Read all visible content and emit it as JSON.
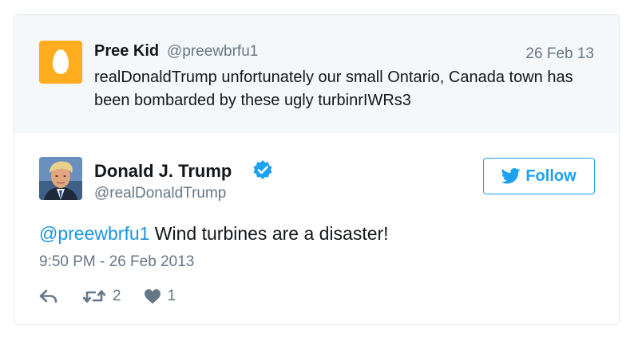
{
  "parent_tweet": {
    "name": "Pree Kid",
    "handle": "@preewbrfu1",
    "date": "26 Feb 13",
    "text": "realDonaldTrump unfortunately our small Ontario, Canada town has been bombarded by these ugly turbinrIWRs3",
    "avatar_icon": "egg-icon",
    "avatar_color": "#ffad1f"
  },
  "tweet": {
    "name": "Donald J. Trump",
    "handle": "@realDonaldTrump",
    "verified_icon": "verified-badge-icon",
    "follow_label": "Follow",
    "mention": "@preewbrfu1",
    "text": " Wind turbines are a disaster!",
    "timestamp": "9:50 PM - 26 Feb 2013",
    "retweet_count": "2",
    "like_count": "1"
  },
  "colors": {
    "accent": "#1da1f2",
    "mention": "#1b95e0",
    "secondary_text": "#657786",
    "parent_background": "#f5f8fa"
  }
}
